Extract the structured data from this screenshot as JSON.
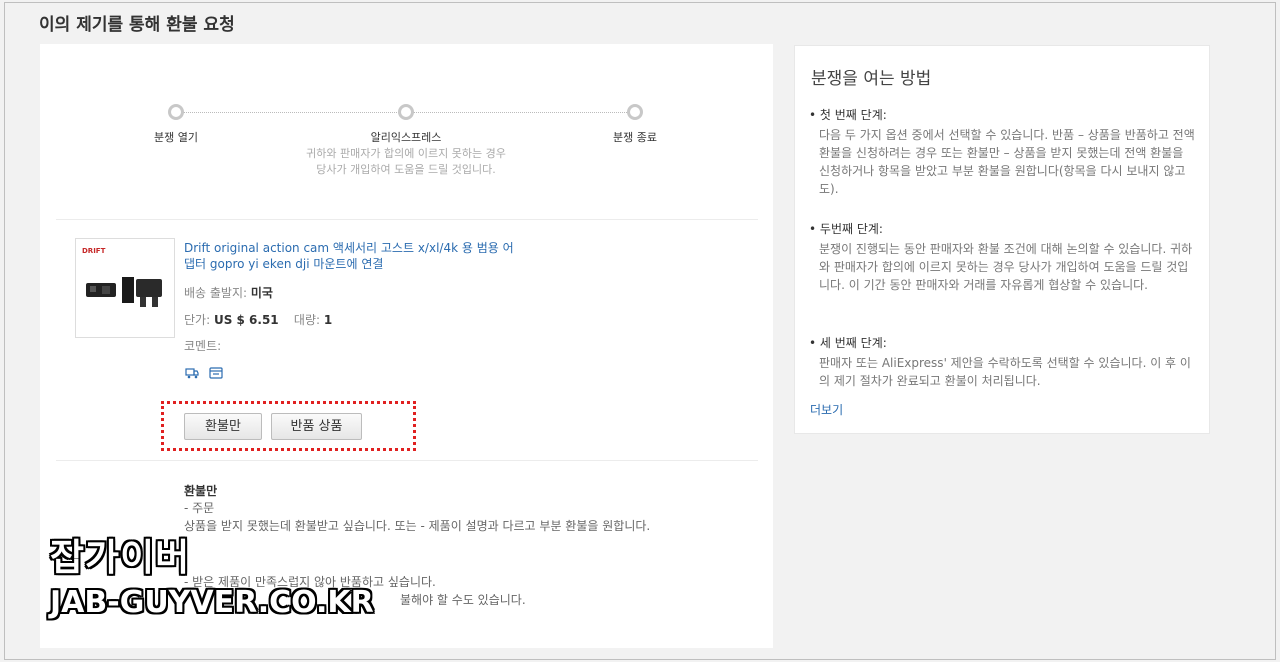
{
  "page": {
    "title": "이의 제기를 통해 환불 요청"
  },
  "progress": {
    "steps": [
      {
        "label": "분쟁 열기"
      },
      {
        "label": "알리익스프레스",
        "desc": "귀하와 판매자가 합의에 이르지 못하는 경우 당사가 개입하여 도움을 드릴 것입니다."
      },
      {
        "label": "분쟁 종료"
      }
    ]
  },
  "product": {
    "title": "Drift original action cam 액세서리 고스트 x/xl/4k 용 범용 어댑터 gopro yi eken dji 마운트에 연결",
    "ship_from_label": "배송 출발지:",
    "ship_from_value": "미국",
    "unit_price_label": "단가:",
    "unit_price_value": "US $ 6.51",
    "qty_label": "대량:",
    "qty_value": "1",
    "comment_label": "코멘트:",
    "image_brand": "DRIFT"
  },
  "buttons": {
    "refund_only": "환불만",
    "return_item": "반품 상품"
  },
  "refund_info": {
    "title": "환불만",
    "lines": [
      "- 주문",
      "상품을 받지 못했는데 환불받고 싶습니다. 또는 - 제품이 설명과 다르고 부분 환불을 원합니다.",
      "- 받은 제품이 만족스럽지 않아 반품하고 싶습니다.",
      "불해야 할 수도 있습니다."
    ]
  },
  "side": {
    "title": "분쟁을 여는 방법",
    "steps": [
      {
        "head": "첫 번째 단계:",
        "body": "다음 두 가지 옵션 중에서 선택할 수 있습니다. 반품 – 상품을 반품하고 전액 환불을 신청하려는 경우 또는 환불만 – 상품을 받지 못했는데 전액 환불을 신청하거나 항목을 받았고 부분 환불을 원합니다(항목을 다시 보내지 않고도)."
      },
      {
        "head": "두번째 단계:",
        "body": "분쟁이 진행되는 동안 판매자와 환불 조건에 대해 논의할 수 있습니다. 귀하와 판매자가 합의에 이르지 못하는 경우 당사가 개입하여 도움을 드릴 것입니다. 이 기간 동안 판매자와 거래를 자유롭게 협상할 수 있습니다."
      },
      {
        "head": "세 번째 단계:",
        "body": "판매자 또는 AliExpress' 제안을 수락하도록 선택할 수 있습니다. 이 후 이의 제기 절차가 완료되고 환불이 처리됩니다."
      }
    ],
    "more": "더보기"
  },
  "watermark": {
    "line1": "잡가이버",
    "line2": "JAB-GUYVER.CO.KR"
  },
  "colors": {
    "link": "#2b6cb0",
    "highlight_box": "#e02020"
  }
}
